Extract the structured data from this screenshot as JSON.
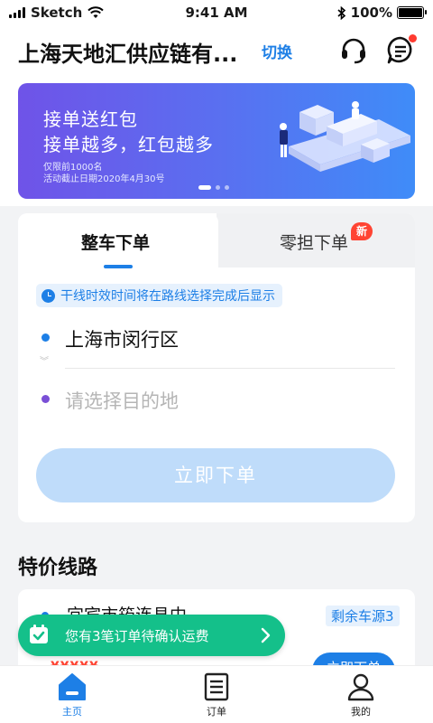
{
  "status_bar": {
    "carrier": "Sketch",
    "time": "9:41 AM",
    "battery": "100%",
    "battery_level": 1.0
  },
  "header": {
    "company_name": "上海天地汇供应链有...",
    "switch_label": "切换",
    "icons": [
      "headset-icon",
      "message-icon"
    ],
    "message_has_unread": true
  },
  "banner": {
    "title_line1": "接单送红包",
    "title_line2": "接单越多，红包越多",
    "note_line1": "仅限前1000名",
    "note_line2": "活动截止日期2020年4月30号",
    "slide_count": 3,
    "active_slide": 1
  },
  "order": {
    "tabs": [
      {
        "label": "整车下单",
        "active": true
      },
      {
        "label": "零担下单",
        "badge": "新"
      }
    ],
    "tip": "干线时效时间将在路线选择完成后显示",
    "origin": "上海市闵行区",
    "destination_placeholder": "请选择目的地",
    "submit_label": "立即下单"
  },
  "special_routes": {
    "title": "特价线路",
    "items": [
      {
        "route": "宜宾市筠连县中...",
        "remaining": "剩余车源3",
        "action": "立即下单",
        "price": "¥¥¥¥¥"
      }
    ]
  },
  "toast": {
    "text": "您有3笔订单待确认运费"
  },
  "nav": {
    "items": [
      {
        "label": "主页",
        "icon": "home-icon",
        "active": true
      },
      {
        "label": "订单",
        "icon": "orders-icon"
      },
      {
        "label": "我的",
        "icon": "profile-icon"
      }
    ]
  },
  "colors": {
    "accent": "#1d7fe6",
    "toast_green": "#14c08a",
    "badge_red": "#ff4433",
    "banner_start": "#6f53e8",
    "banner_end": "#3f8cf8"
  }
}
